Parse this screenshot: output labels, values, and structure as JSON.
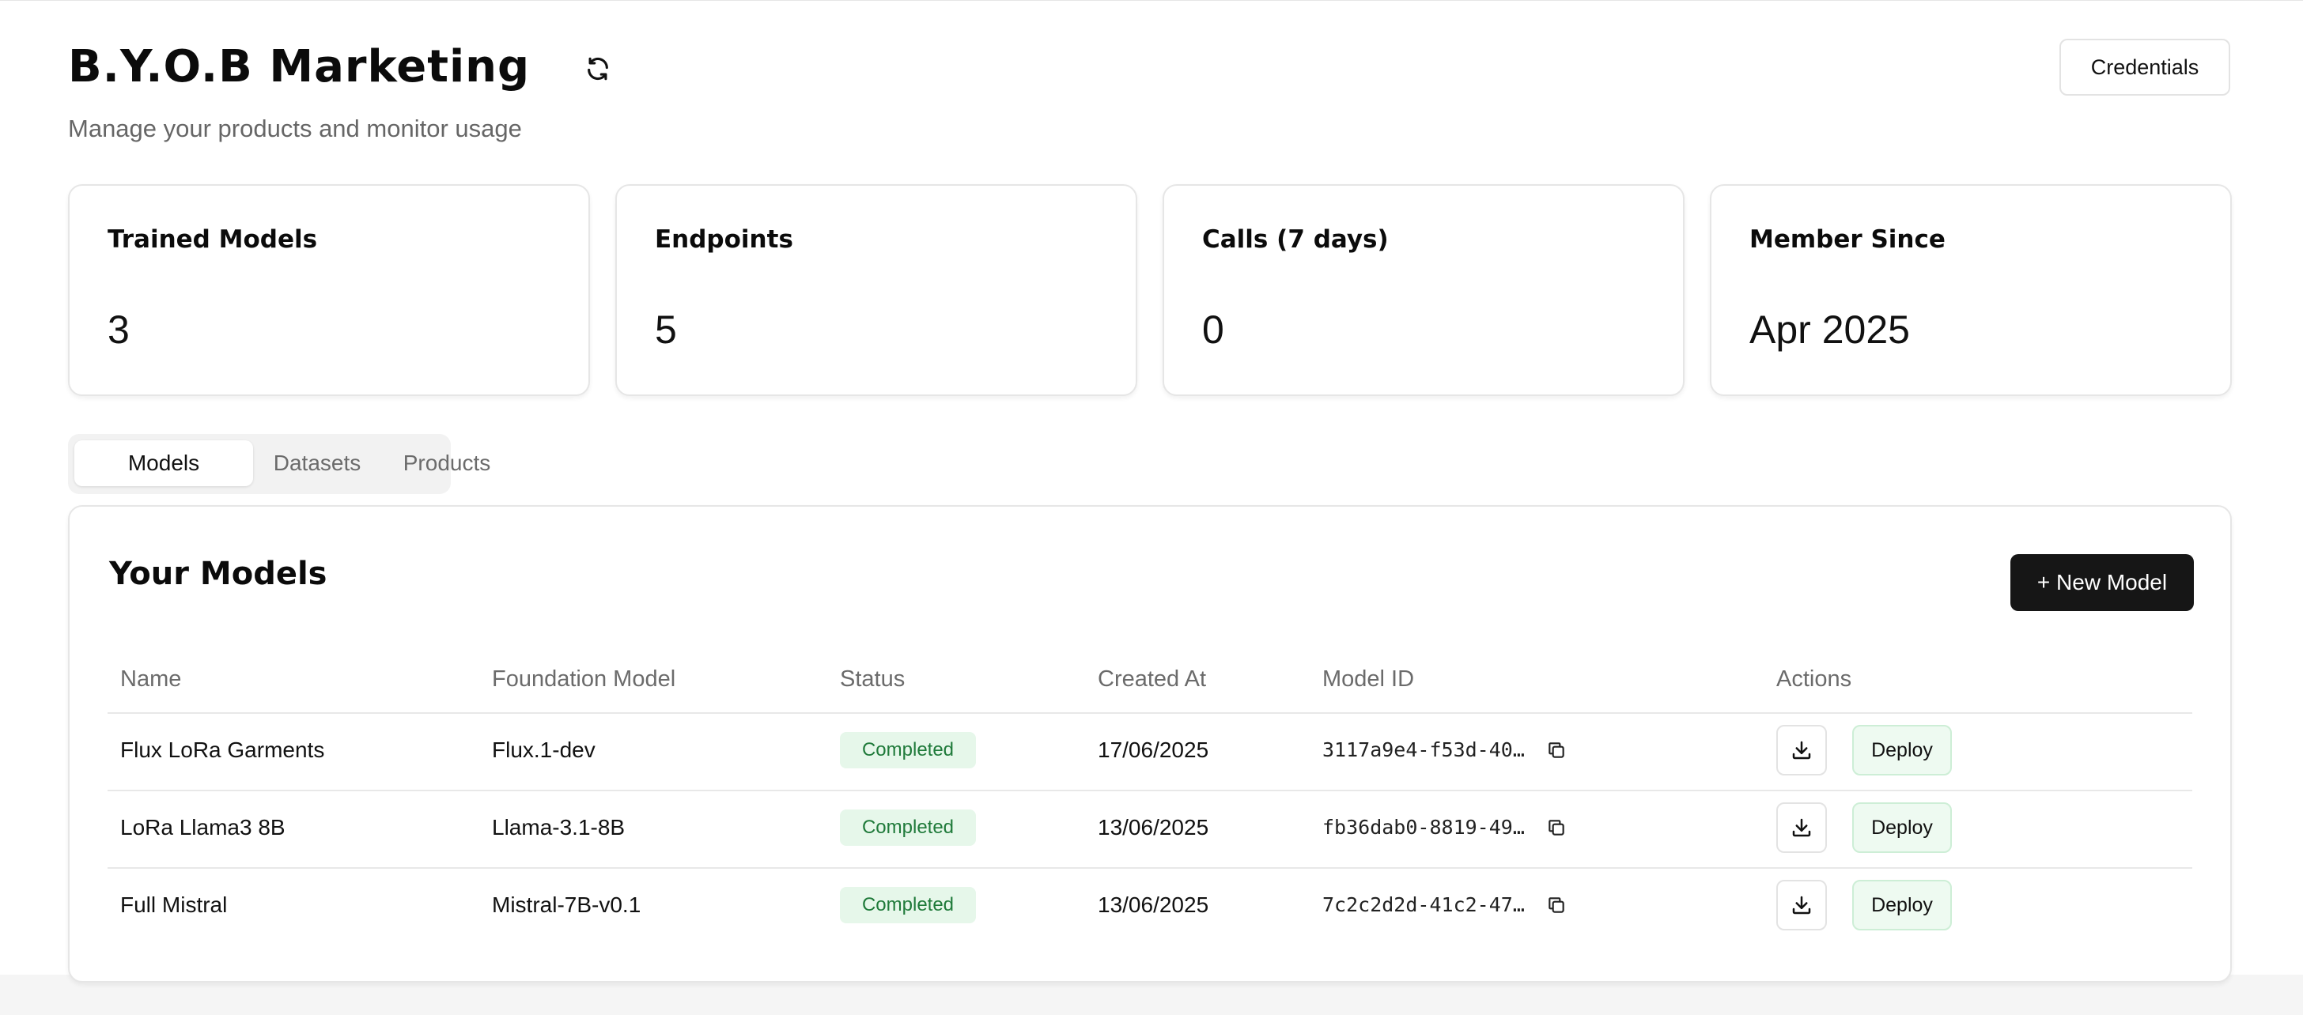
{
  "header": {
    "title": "B.Y.O.B Marketing",
    "subtitle": "Manage your products and monitor usage",
    "credentials_label": "Credentials",
    "refresh_icon": "refresh-icon"
  },
  "stats": [
    {
      "label": "Trained Models",
      "value": "3"
    },
    {
      "label": "Endpoints",
      "value": "5"
    },
    {
      "label": "Calls (7 days)",
      "value": "0"
    },
    {
      "label": "Member Since",
      "value": "Apr 2025"
    }
  ],
  "tabs": [
    {
      "label": "Models",
      "active": true
    },
    {
      "label": "Datasets",
      "active": false
    },
    {
      "label": "Products",
      "active": false
    }
  ],
  "models_panel": {
    "title": "Your Models",
    "new_button_label": "+ New Model",
    "columns": [
      "Name",
      "Foundation Model",
      "Status",
      "Created At",
      "Model ID",
      "Actions"
    ],
    "rows": [
      {
        "name": "Flux LoRa Garments",
        "foundation": "Flux.1-dev",
        "status": "Completed",
        "created": "17/06/2025",
        "model_id": "3117a9e4-f53d-40…",
        "deploy_label": "Deploy"
      },
      {
        "name": "LoRa Llama3 8B",
        "foundation": "Llama-3.1-8B",
        "status": "Completed",
        "created": "13/06/2025",
        "model_id": "fb36dab0-8819-49…",
        "deploy_label": "Deploy"
      },
      {
        "name": "Full Mistral",
        "foundation": "Mistral-7B-v0.1",
        "status": "Completed",
        "created": "13/06/2025",
        "model_id": "7c2c2d2d-41c2-47…",
        "deploy_label": "Deploy"
      }
    ]
  },
  "colors": {
    "badge_bg": "#e6f7ea",
    "badge_text": "#1f7a3a",
    "primary_button": "#161616",
    "deploy_bg": "#eefaf1"
  }
}
